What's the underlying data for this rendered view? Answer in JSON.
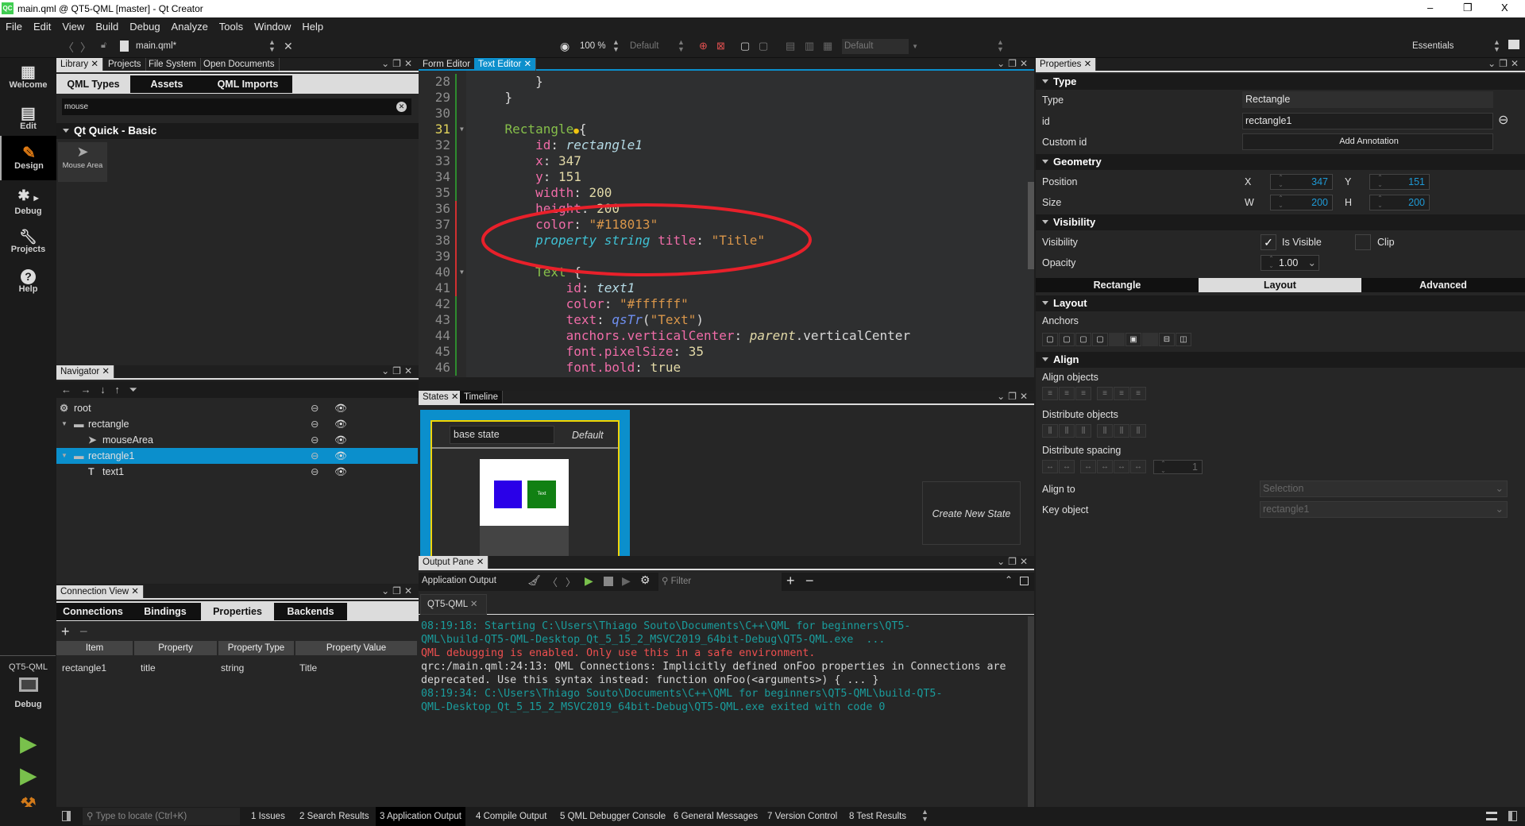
{
  "window": {
    "title": "main.qml @ QT5-QML [master] - Qt Creator",
    "app_icon": "QC",
    "minimize": "–",
    "maximize": "❐",
    "close": "X"
  },
  "menu": [
    "File",
    "Edit",
    "View",
    "Build",
    "Debug",
    "Analyze",
    "Tools",
    "Window",
    "Help"
  ],
  "toolbar": {
    "file_name": "main.qml*",
    "zoom": "100 %",
    "state_combo": "Default",
    "form_combo": "Default",
    "workspace": "Essentials"
  },
  "modes": {
    "welcome": "Welcome",
    "edit": "Edit",
    "design": "Design",
    "debug": "Debug",
    "projects": "Projects",
    "help": "Help",
    "kit_project": "QT5-QML",
    "kit_mode": "Debug"
  },
  "library": {
    "tabs": [
      "Library",
      "Projects",
      "File System",
      "Open Documents"
    ],
    "subtabs": [
      "QML Types",
      "Assets",
      "QML Imports"
    ],
    "search_value": "mouse",
    "section": "Qt Quick - Basic",
    "items": [
      {
        "label": "Mouse Area"
      }
    ]
  },
  "navigator": {
    "tab": "Navigator",
    "rows": [
      {
        "label": "root",
        "icon": "item-icon"
      },
      {
        "label": "rectangle",
        "icon": "rectangle-icon"
      },
      {
        "label": "mouseArea",
        "icon": "mouse-area-icon"
      },
      {
        "label": "rectangle1",
        "icon": "rectangle-icon",
        "selected": true
      },
      {
        "label": "text1",
        "icon": "text-icon"
      }
    ]
  },
  "connection_view": {
    "tab": "Connection View",
    "subtabs": [
      "Connections",
      "Bindings",
      "Properties",
      "Backends"
    ],
    "active_subtab": "Properties",
    "columns": [
      "Item",
      "Property",
      "Property Type",
      "Property Value"
    ],
    "rows": [
      [
        "rectangle1",
        "title",
        "string",
        "Title"
      ]
    ]
  },
  "editor": {
    "tabs": [
      "Form Editor",
      "Text Editor"
    ],
    "current_line": 31,
    "lines": [
      {
        "n": "28",
        "segs": [
          {
            "k": "plain",
            "t": "        }"
          }
        ]
      },
      {
        "n": "29",
        "segs": [
          {
            "k": "plain",
            "t": "    }"
          }
        ]
      },
      {
        "n": "30",
        "segs": []
      },
      {
        "n": "31",
        "fold": true,
        "segs": [
          {
            "k": "plain",
            "t": "    "
          },
          {
            "k": "type",
            "t": "Rectangle"
          },
          {
            "k": "bulb",
            "t": ""
          },
          {
            "k": "plain",
            "t": "{"
          }
        ]
      },
      {
        "n": "32",
        "segs": [
          {
            "k": "prop",
            "t": "        id"
          },
          {
            "k": "plain",
            "t": ": "
          },
          {
            "k": "idv",
            "t": "rectangle1"
          }
        ]
      },
      {
        "n": "33",
        "segs": [
          {
            "k": "prop",
            "t": "        x"
          },
          {
            "k": "plain",
            "t": ": "
          },
          {
            "k": "num",
            "t": "347"
          }
        ]
      },
      {
        "n": "34",
        "segs": [
          {
            "k": "prop",
            "t": "        y"
          },
          {
            "k": "plain",
            "t": ": "
          },
          {
            "k": "num",
            "t": "151"
          }
        ]
      },
      {
        "n": "35",
        "segs": [
          {
            "k": "prop",
            "t": "        width"
          },
          {
            "k": "plain",
            "t": ": "
          },
          {
            "k": "num",
            "t": "200"
          }
        ]
      },
      {
        "n": "36",
        "segs": [
          {
            "k": "prop",
            "t": "        height"
          },
          {
            "k": "plain",
            "t": ": "
          },
          {
            "k": "num",
            "t": "200"
          }
        ]
      },
      {
        "n": "37",
        "segs": [
          {
            "k": "prop",
            "t": "        color"
          },
          {
            "k": "plain",
            "t": ": "
          },
          {
            "k": "str",
            "t": "\"#118013\""
          }
        ]
      },
      {
        "n": "38",
        "segs": [
          {
            "k": "kw",
            "t": "        property"
          },
          {
            "k": "plain",
            "t": " "
          },
          {
            "k": "kw",
            "t": "string"
          },
          {
            "k": "plain",
            "t": " "
          },
          {
            "k": "prop",
            "t": "title"
          },
          {
            "k": "plain",
            "t": ": "
          },
          {
            "k": "str",
            "t": "\"Title\""
          }
        ]
      },
      {
        "n": "39",
        "segs": []
      },
      {
        "n": "40",
        "fold": true,
        "segs": [
          {
            "k": "type",
            "t": "        Text"
          },
          {
            "k": "plain",
            "t": " {"
          }
        ]
      },
      {
        "n": "41",
        "segs": [
          {
            "k": "prop",
            "t": "            id"
          },
          {
            "k": "plain",
            "t": ": "
          },
          {
            "k": "idv",
            "t": "text1"
          }
        ]
      },
      {
        "n": "42",
        "segs": [
          {
            "k": "prop",
            "t": "            color"
          },
          {
            "k": "plain",
            "t": ": "
          },
          {
            "k": "str",
            "t": "\"#ffffff\""
          }
        ]
      },
      {
        "n": "43",
        "segs": [
          {
            "k": "prop",
            "t": "            text"
          },
          {
            "k": "plain",
            "t": ": "
          },
          {
            "k": "fn",
            "t": "qsTr"
          },
          {
            "k": "plain",
            "t": "("
          },
          {
            "k": "str",
            "t": "\"Text\""
          },
          {
            "k": "plain",
            "t": ")"
          }
        ]
      },
      {
        "n": "44",
        "segs": [
          {
            "k": "prop",
            "t": "            anchors.verticalCenter"
          },
          {
            "k": "plain",
            "t": ": "
          },
          {
            "k": "par",
            "t": "parent"
          },
          {
            "k": "plain",
            "t": ".verticalCenter"
          }
        ]
      },
      {
        "n": "45",
        "segs": [
          {
            "k": "prop",
            "t": "            font.pixelSize"
          },
          {
            "k": "plain",
            "t": ": "
          },
          {
            "k": "num",
            "t": "35"
          }
        ]
      },
      {
        "n": "46",
        "segs": [
          {
            "k": "prop",
            "t": "            font.bold"
          },
          {
            "k": "plain",
            "t": ": "
          },
          {
            "k": "num",
            "t": "true"
          }
        ]
      }
    ],
    "annotation_color": "#e8202a"
  },
  "states": {
    "tabs": [
      "States",
      "Timeline"
    ],
    "base_state": "base state",
    "default_label": "Default",
    "preview_text": "Text",
    "create_new": "Create New State"
  },
  "output": {
    "tab": "Output Pane",
    "title": "Application Output",
    "filter_placeholder": "Filter",
    "run_tab": "QT5-QML",
    "lines": [
      {
        "c": "#1a9c9c",
        "t": "08:19:18: Starting C:\\Users\\Thiago Souto\\Documents\\C++\\QML for beginners\\QT5-"
      },
      {
        "c": "#1a9c9c",
        "t": "QML\\build-QT5-QML-Desktop_Qt_5_15_2_MSVC2019_64bit-Debug\\QT5-QML.exe  ..."
      },
      {
        "c": "#ef4f4f",
        "t": "QML debugging is enabled. Only use this in a safe environment."
      },
      {
        "c": "#d6d6d6",
        "t": "qrc:/main.qml:24:13: QML Connections: Implicitly defined onFoo properties in Connections are"
      },
      {
        "c": "#d6d6d6",
        "t": "deprecated. Use this syntax instead: function onFoo(<arguments>) { ... }"
      },
      {
        "c": "#1a9c9c",
        "t": "08:19:34: C:\\Users\\Thiago Souto\\Documents\\C++\\QML for beginners\\QT5-QML\\build-QT5-"
      },
      {
        "c": "#1a9c9c",
        "t": "QML-Desktop_Qt_5_15_2_MSVC2019_64bit-Debug\\QT5-QML.exe exited with code 0"
      }
    ]
  },
  "properties": {
    "tab": "Properties",
    "sections": {
      "type": "Type",
      "geometry": "Geometry",
      "visibility": "Visibility",
      "layout": "Layout",
      "align": "Align"
    },
    "type_label": "Type",
    "type_value": "Rectangle",
    "id_label": "id",
    "id_value": "rectangle1",
    "custom_id_label": "Custom id",
    "add_annotation": "Add Annotation",
    "position_label": "Position",
    "x_label": "X",
    "x": "347",
    "y_label": "Y",
    "y": "151",
    "size_label": "Size",
    "w_label": "W",
    "w": "200",
    "h_label": "H",
    "h": "200",
    "visibility_label": "Visibility",
    "is_visible": "Is Visible",
    "is_visible_checked": true,
    "clip": "Clip",
    "clip_checked": false,
    "opacity_label": "Opacity",
    "opacity": "1.00",
    "tabs": [
      "Rectangle",
      "Layout",
      "Advanced"
    ],
    "active_tab": "Layout",
    "anchors_label": "Anchors",
    "align_objects": "Align objects",
    "distribute_objects": "Distribute objects",
    "distribute_spacing": "Distribute spacing",
    "spacing_value": "1",
    "align_to_label": "Align to",
    "align_to_value": "Selection",
    "key_object_label": "Key object",
    "key_object_value": "rectangle1"
  },
  "statusbar": {
    "locate_placeholder": "Type to locate (Ctrl+K)",
    "items": [
      "1  Issues",
      "2  Search Results",
      "3  Application Output",
      "4  Compile Output",
      "5  QML Debugger Console",
      "6  General Messages",
      "7  Version Control",
      "8  Test Results"
    ],
    "active_item": 2
  },
  "colors": {
    "accent": "#0b8fcc",
    "selection_frame": "#f2d500",
    "preview_blue": "#2a00e8",
    "preview_green": "#118013"
  }
}
